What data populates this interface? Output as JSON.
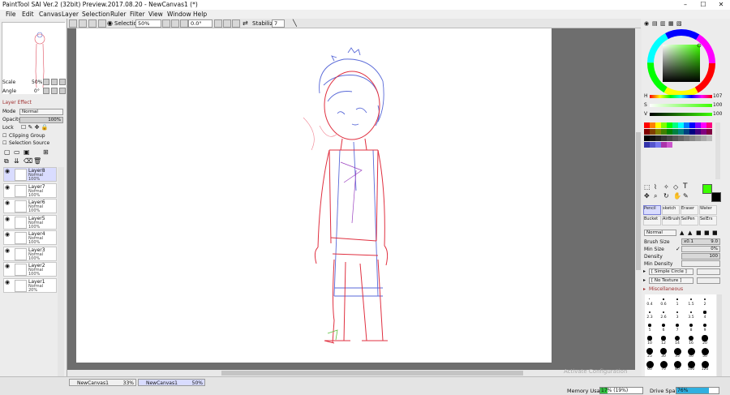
{
  "window": {
    "title": "PaintTool SAI Ver.2 (32bit) Preview.2017.08.20 - NewCanvas1 (*)",
    "controls": [
      "–",
      "☐",
      "✕"
    ]
  },
  "menu": [
    "File",
    "Edit",
    "Canvas",
    "Layer",
    "Selection",
    "Ruler",
    "Filter",
    "View",
    "Window",
    "Help"
  ],
  "toolbar": {
    "selection_label": "Selection",
    "zoom": "50%",
    "rotation": "0.0°",
    "stabilizer_label": "Stabilizer",
    "stabilizer_value": "7"
  },
  "navigator": {
    "scale_label": "Scale",
    "scale_value": "50%",
    "angle_label": "Angle",
    "angle_value": "0°"
  },
  "layer_panel": {
    "section_title": "Layer Effect",
    "mode_label": "Mode",
    "mode_value": "Normal",
    "opacity_label": "Opacity",
    "opacity_value": "100%",
    "lock_label": "Lock",
    "clipping_label": "Clipping Group",
    "selection_source_label": "Selection Source",
    "layers": [
      {
        "name": "Layer8",
        "mode": "Normal",
        "opacity": "100%",
        "selected": true
      },
      {
        "name": "Layer7",
        "mode": "Normal",
        "opacity": "100%",
        "selected": false
      },
      {
        "name": "Layer6",
        "mode": "Normal",
        "opacity": "100%",
        "selected": false
      },
      {
        "name": "Layer5",
        "mode": "Normal",
        "opacity": "100%",
        "selected": false
      },
      {
        "name": "Layer4",
        "mode": "Normal",
        "opacity": "100%",
        "selected": false
      },
      {
        "name": "Layer3",
        "mode": "Normal",
        "opacity": "100%",
        "selected": false
      },
      {
        "name": "Layer2",
        "mode": "Normal",
        "opacity": "100%",
        "selected": false
      },
      {
        "name": "Layer1",
        "mode": "Normal",
        "opacity": "20%",
        "selected": false
      }
    ]
  },
  "color": {
    "h_label": "H",
    "h_value": "107",
    "s_label": "S",
    "s_value": "100",
    "v_label": "V",
    "v_value": "100",
    "current": "#3cff00",
    "palette": [
      "#ff0000",
      "#ff8000",
      "#ffff00",
      "#80ff00",
      "#00ff00",
      "#00ff80",
      "#00ffff",
      "#0080ff",
      "#0000ff",
      "#8000ff",
      "#ff00ff",
      "#ff0080",
      "#800000",
      "#804000",
      "#808000",
      "#408000",
      "#008000",
      "#008040",
      "#008080",
      "#004080",
      "#000080",
      "#400080",
      "#800080",
      "#800040",
      "#000000",
      "#111111",
      "#222222",
      "#333333",
      "#444444",
      "#555555",
      "#666666",
      "#777777",
      "#888888",
      "#999999",
      "#aaaaaa",
      "#bbbbbb",
      "#3333aa",
      "#5555cc",
      "#7777ee",
      "#aa33aa",
      "#cc55cc"
    ]
  },
  "tools": {
    "brush_tools": [
      "Pencil",
      "sketch",
      "Eraser",
      "Water",
      "Bucket",
      "AirBrush",
      "SelPen",
      "SelErs"
    ],
    "brush_mode": "Normal",
    "brush_size_label": "Brush Size",
    "brush_size_mult": "x0.1",
    "brush_size_value": "9.0",
    "min_size_label": "Min Size",
    "min_size_value": "0%",
    "density_label": "Density",
    "density_value": "100",
    "min_density_label": "Min Density",
    "shape_value": "[ Simple Circle ]",
    "texture_value": "[ No Texture ]",
    "misc_label": "Miscellaneous",
    "brush_sizes": [
      "0.4",
      "0.6",
      "1",
      "1.5",
      "2",
      "2.3",
      "2.6",
      "3",
      "3.5",
      "4",
      "5",
      "6",
      "7",
      "8",
      "9",
      "10",
      "12",
      "14",
      "16",
      "20",
      "25",
      "30",
      "35",
      "40",
      "50",
      "60",
      "70",
      "80",
      "100",
      "120"
    ]
  },
  "tabs": [
    {
      "name": "NewCanvas1",
      "zoom": "33%"
    },
    {
      "name": "NewCanvas1",
      "zoom": "50%"
    }
  ],
  "status": {
    "memory_label": "Memory Usage",
    "memory_value": "17% (19%)",
    "drive_label": "Drive Space",
    "drive_value": "76%",
    "watermark": "Activate Configuration"
  }
}
